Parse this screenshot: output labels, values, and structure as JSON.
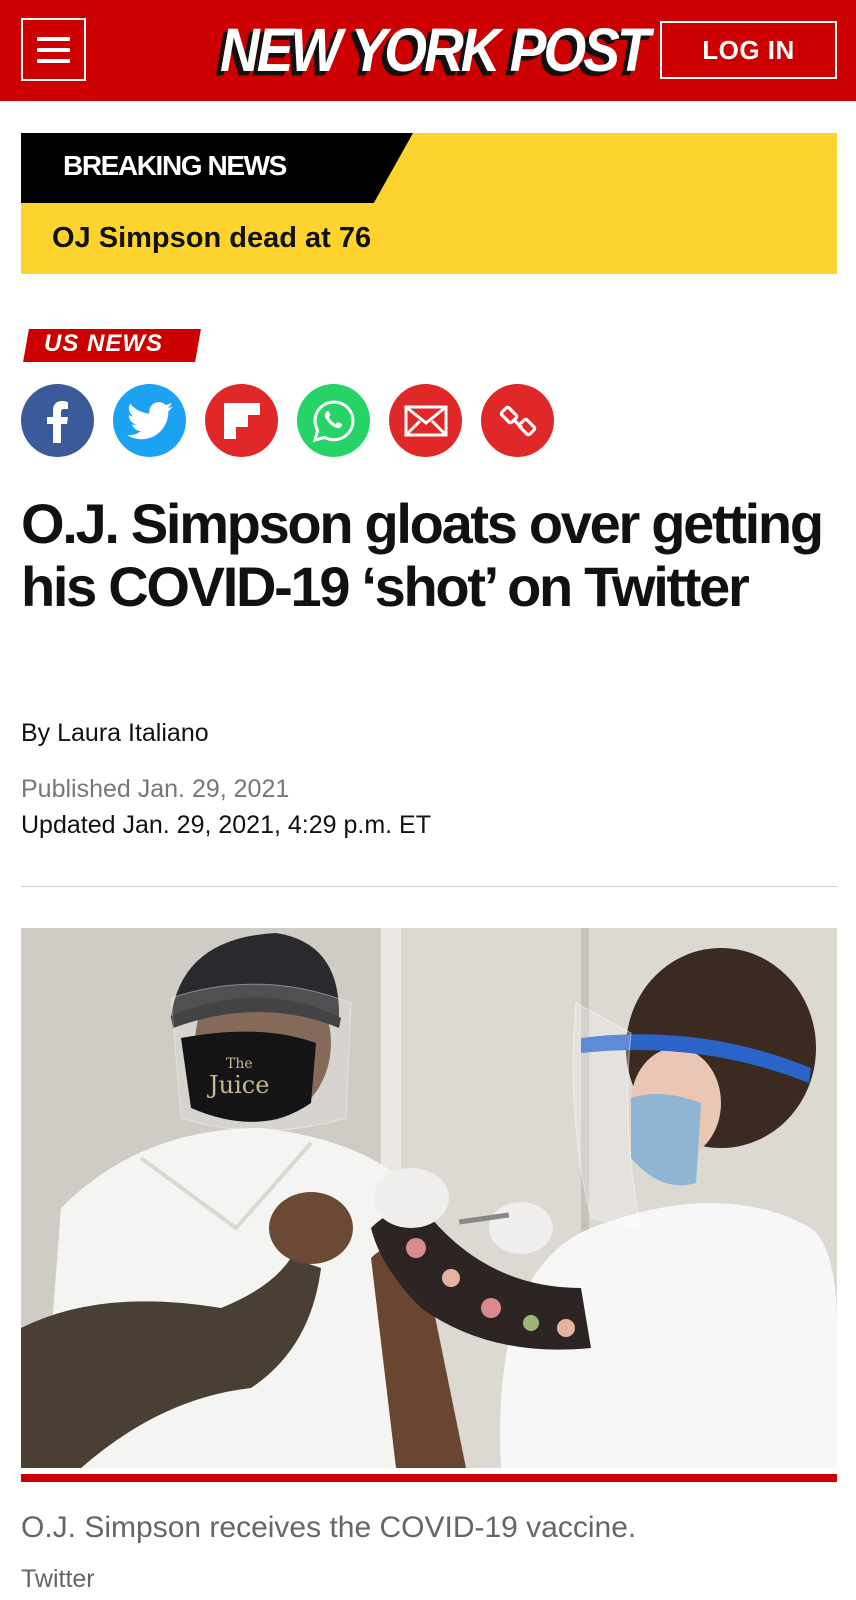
{
  "header": {
    "logo_text": "NEW YORK POST",
    "login_label": "LOG IN",
    "menu_icon": "hamburger-menu-icon",
    "brand_color": "#cc0000"
  },
  "breaking": {
    "tag": "BREAKING NEWS",
    "headline": "OJ Simpson dead at 76",
    "bg_color": "#fdd42d"
  },
  "article": {
    "section": "US NEWS",
    "share_icons": [
      "facebook-icon",
      "twitter-icon",
      "flipboard-icon",
      "whatsapp-icon",
      "email-icon",
      "link-icon"
    ],
    "headline": "O.J. Simpson gloats over getting his COVID-19 ‘shot’ on Twitter",
    "byline": "By Laura Italiano",
    "published": "Published Jan. 29, 2021",
    "updated": "Updated Jan. 29, 2021, 4:29 p.m. ET",
    "photo": {
      "mask_text_small": "The",
      "mask_text": "Juice",
      "caption": "O.J. Simpson receives the COVID-19 vaccine.",
      "credit": "Twitter"
    }
  }
}
